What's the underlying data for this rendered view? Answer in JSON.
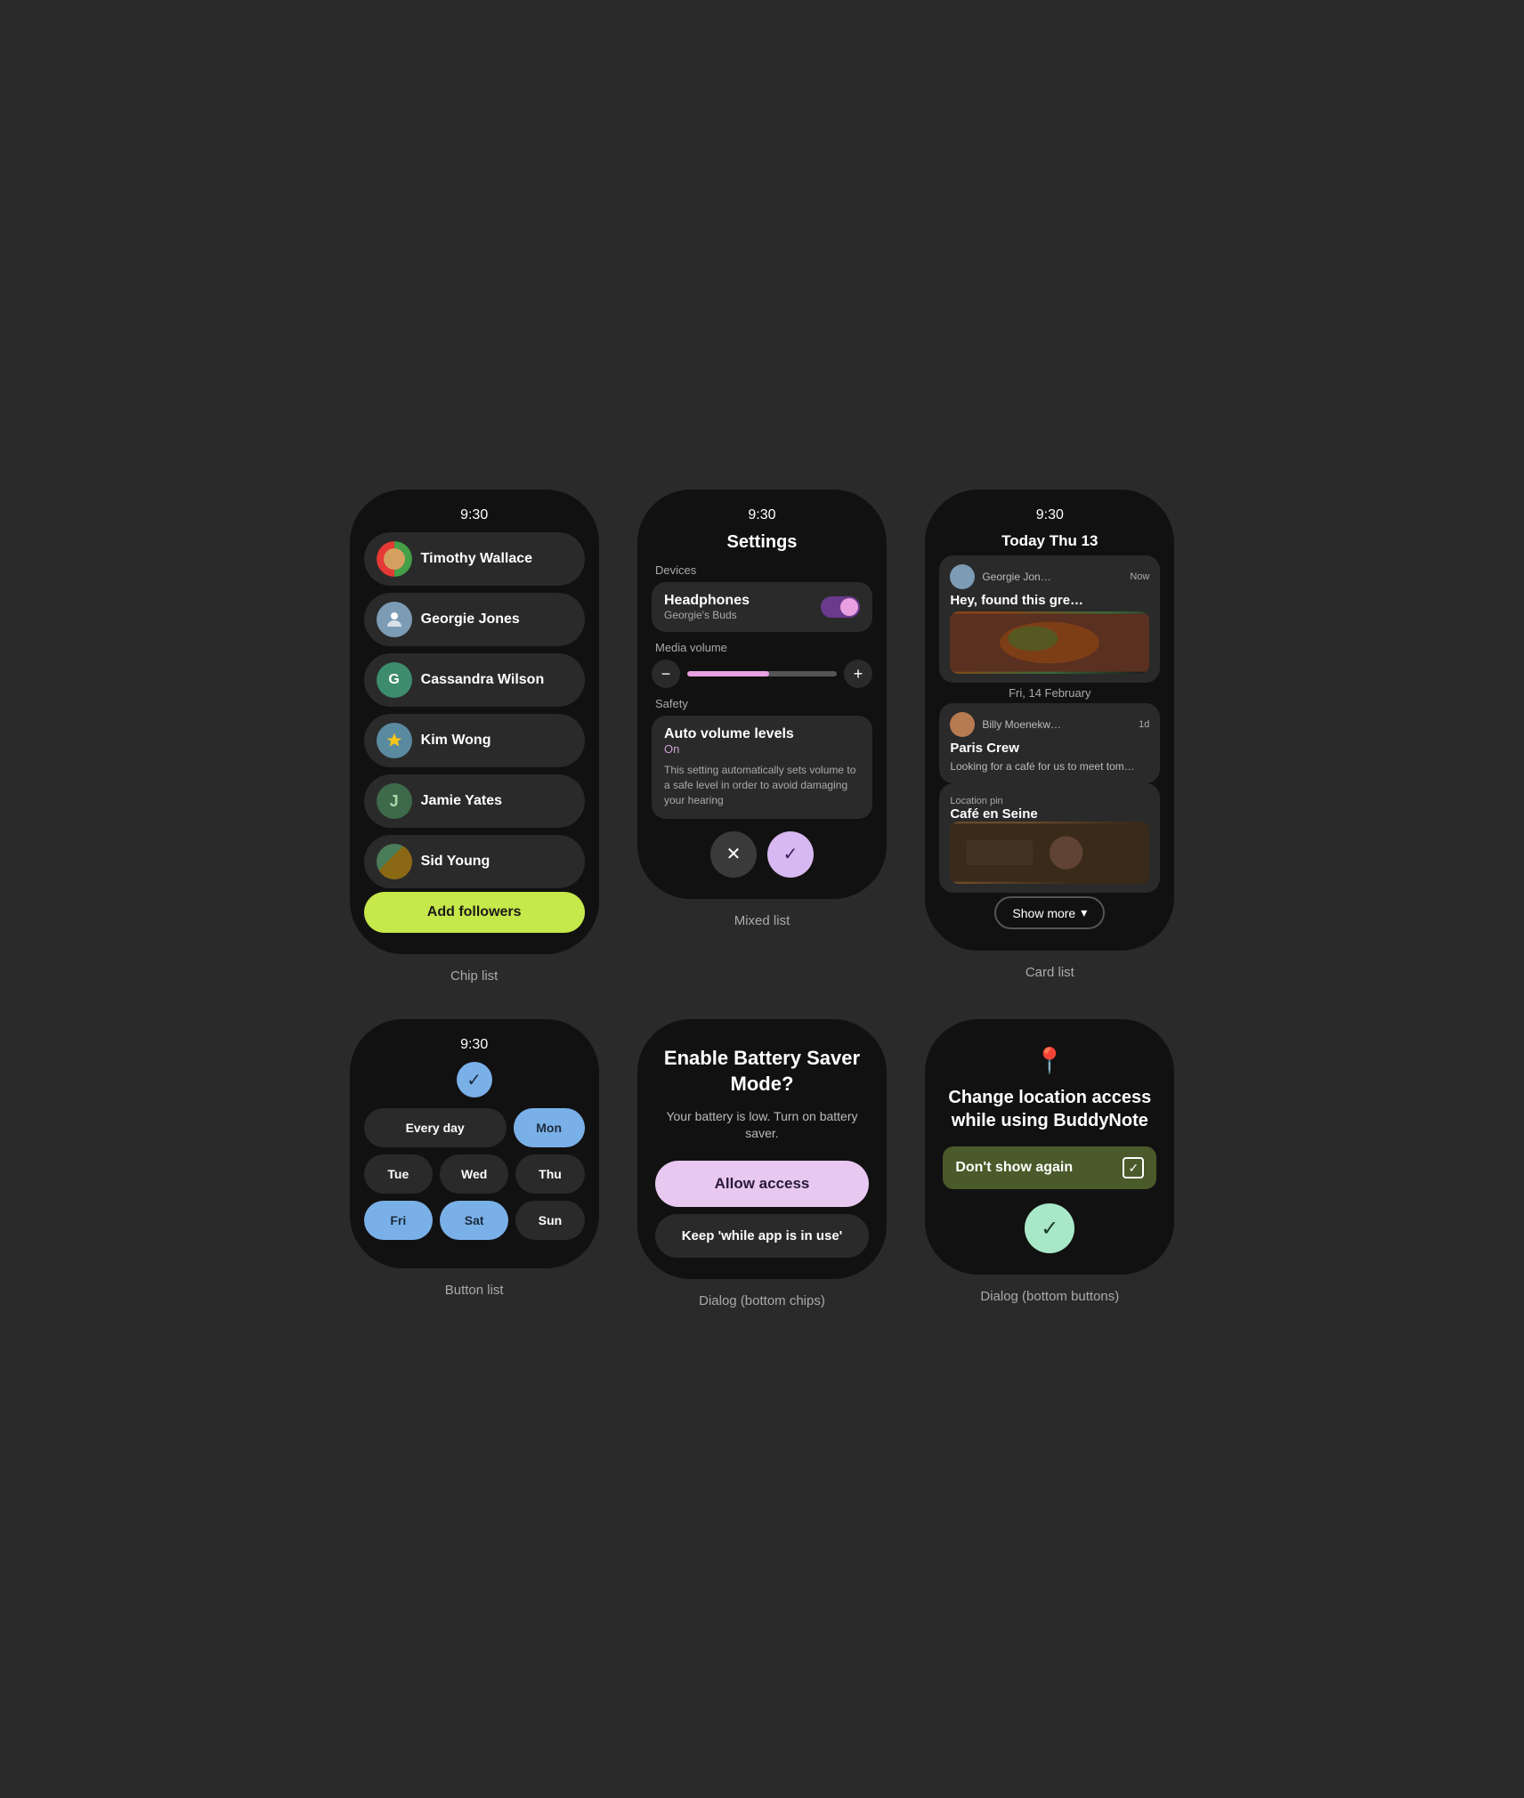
{
  "app": {
    "background": "#2a2a2a"
  },
  "devices": [
    {
      "id": "chip-list",
      "label": "Chip list",
      "time": "9:30",
      "contacts": [
        {
          "name": "Timothy Wallace",
          "avatar_type": "split",
          "colors": [
            "#e53935",
            "#43a047"
          ]
        },
        {
          "name": "Georgie Jones",
          "avatar_type": "color",
          "color": "#7c9bb5"
        },
        {
          "name": "Cassandra Wilson",
          "avatar_type": "initial",
          "initial": "G",
          "color": "#2d7a7a"
        },
        {
          "name": "Kim Wong",
          "avatar_type": "star-color",
          "color": "#5a8a9f"
        },
        {
          "name": "Jamie Yates",
          "avatar_type": "initial",
          "initial": "J",
          "color": "#3d6a4a"
        },
        {
          "name": "Sid Young",
          "avatar_type": "nature",
          "color": "#4a7c59"
        }
      ],
      "add_button": "Add followers"
    },
    {
      "id": "mixed-list",
      "label": "Mixed list",
      "time": "9:30",
      "title": "Settings",
      "devices_label": "Devices",
      "headphones_title": "Headphones",
      "headphones_sub": "Georgie's Buds",
      "media_volume_label": "Media volume",
      "safety_label": "Safety",
      "auto_volume_title": "Auto volume levels",
      "auto_volume_sub": "On",
      "auto_volume_desc": "This setting automatically sets volume to a safe level in order to avoid damaging your hearing",
      "cancel_label": "✕",
      "confirm_label": "✓"
    },
    {
      "id": "card-list",
      "label": "Card list",
      "time": "9:30",
      "today_header": "Today Thu 13",
      "messages": [
        {
          "sender": "Georgie Jon…",
          "time": "Now",
          "title": "Hey, found this gre…",
          "has_image": true
        }
      ],
      "date_divider": "Fri, 14 February",
      "messages2": [
        {
          "sender": "Billy Moenekw…",
          "time": "1d",
          "title": "Paris Crew",
          "body": "Looking for a café for us to meet tom…"
        }
      ],
      "location_label": "Location pin",
      "location_name": "Café en Seine",
      "show_more": "Show more"
    },
    {
      "id": "button-list",
      "label": "Button list",
      "time": "9:30",
      "days": [
        {
          "label": "Every day",
          "active": false,
          "wide": true
        },
        {
          "label": "Mon",
          "active": true,
          "wide": false
        },
        {
          "label": "Tue",
          "active": false,
          "wide": false
        },
        {
          "label": "Wed",
          "active": false,
          "wide": false
        },
        {
          "label": "Thu",
          "active": false,
          "wide": false
        },
        {
          "label": "Fri",
          "active": true,
          "wide": false
        },
        {
          "label": "Sat",
          "active": true,
          "wide": false
        },
        {
          "label": "Sun",
          "active": false,
          "wide": false
        }
      ]
    },
    {
      "id": "dialog-chips",
      "label": "Dialog (bottom chips)",
      "title": "Enable Battery Saver Mode?",
      "body": "Your battery is low. Turn on battery saver.",
      "allow_btn": "Allow access",
      "keep_btn": "Keep 'while app is in use'"
    },
    {
      "id": "dialog-buttons",
      "label": "Dialog (bottom buttons)",
      "icon": "📍",
      "title": "Change location access while using BuddyNote",
      "dont_show": "Don't show again",
      "confirm_label": "✓"
    }
  ]
}
